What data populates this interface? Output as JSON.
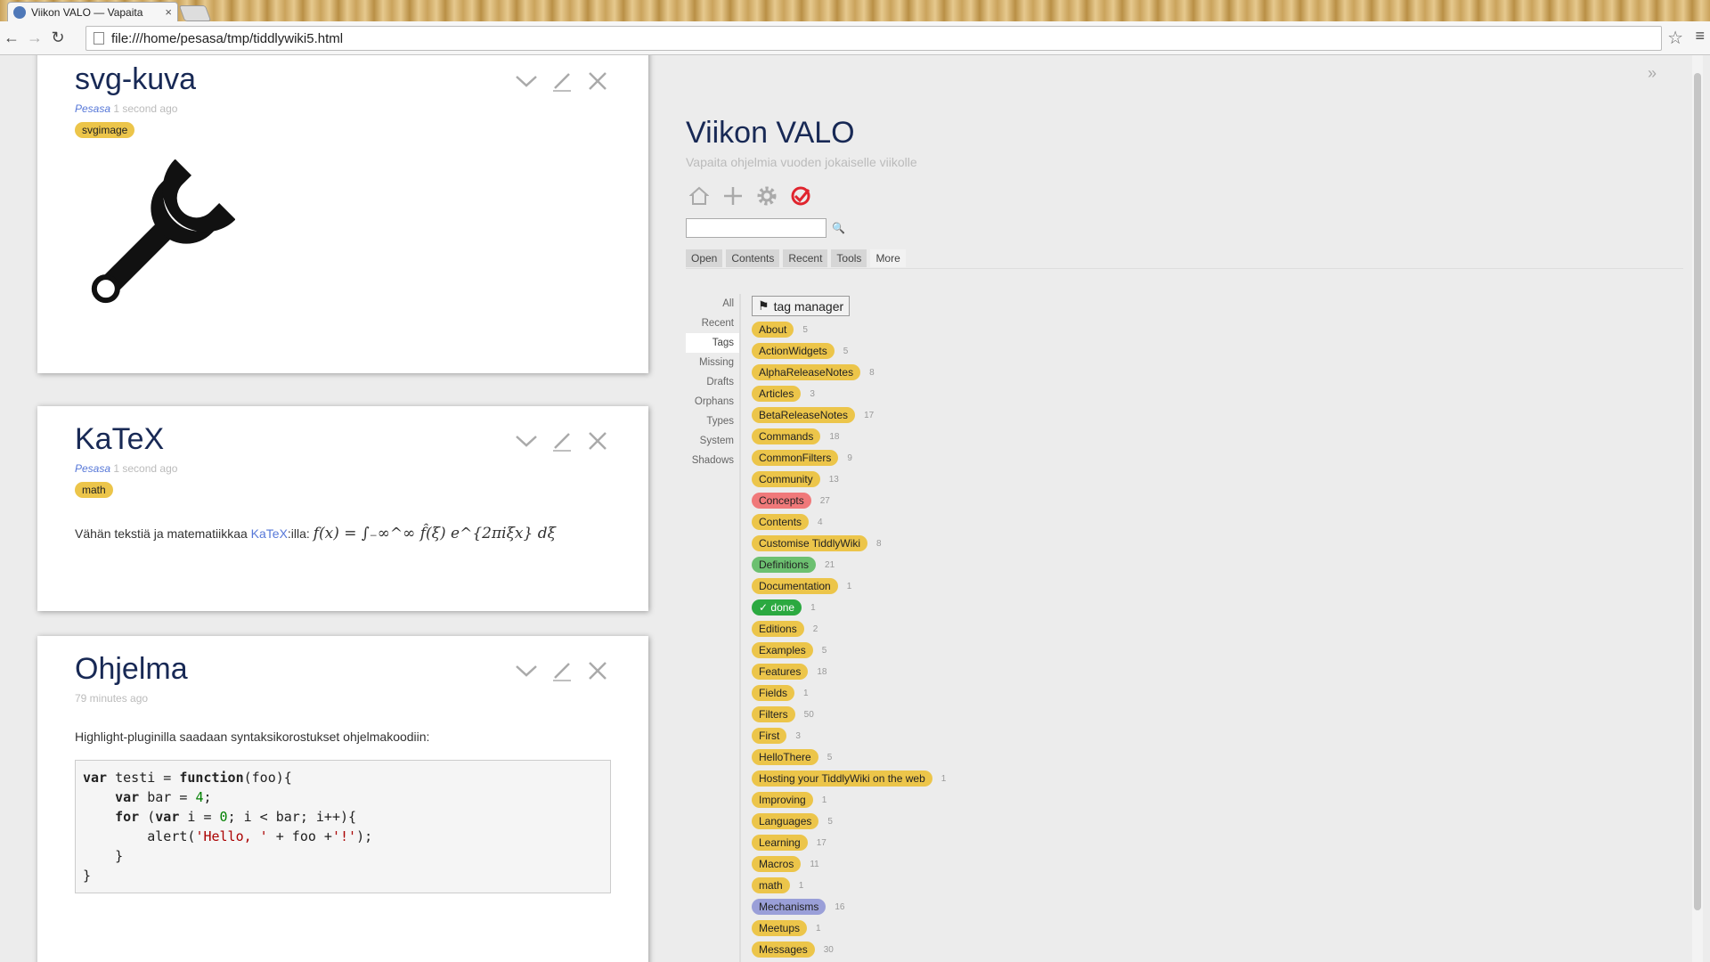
{
  "browser": {
    "tab_title": "Viikon VALO — Vapaita",
    "tab_close": "×",
    "url": "file:///home/pesasa/tmp/tiddlywiki5.html"
  },
  "story": {
    "tiddlers": [
      {
        "title": "svg-kuva",
        "modifier": "Pesasa",
        "modified": "1 second ago",
        "tag": "svgimage"
      },
      {
        "title": "KaTeX",
        "modifier": "Pesasa",
        "modified": "1 second ago",
        "tag": "math",
        "body_prefix": "Vähän tekstiä ja matematiikkaa ",
        "link": "KaTeX",
        "body_suffix": ":illa:",
        "formula": "f(x) = ∫₋∞^∞ f̂(ξ) e^{2πiξx} dξ"
      },
      {
        "title": "Ohjelma",
        "modified": "79 minutes ago",
        "body": "Highlight-pluginilla saadaan syntaksikorostukset ohjelmakoodiin:",
        "code": [
          "var testi = function(foo){",
          "    var bar = 4;",
          "    for (var i = 0; i < bar; i++){",
          "        alert('Hello, ' + foo +'!');",
          "    }",
          "}"
        ]
      }
    ]
  },
  "sidebar": {
    "site_title": "Viikon VALO",
    "site_subtitle": "Vapaita ohjelmia vuoden jokaiselle viikolle",
    "tabs": [
      "Open",
      "Contents",
      "Recent",
      "Tools",
      "More"
    ],
    "active_tab": "More",
    "subtabs": [
      "All",
      "Recent",
      "Tags",
      "Missing",
      "Drafts",
      "Orphans",
      "Types",
      "System",
      "Shadows"
    ],
    "active_subtab": "Tags",
    "tag_manager_label": "tag manager",
    "tags": [
      {
        "name": "About",
        "count": "5",
        "color": "#ecc54a"
      },
      {
        "name": "ActionWidgets",
        "count": "5",
        "color": "#ecc54a"
      },
      {
        "name": "AlphaReleaseNotes",
        "count": "8",
        "color": "#ecc54a"
      },
      {
        "name": "Articles",
        "count": "3",
        "color": "#ecc54a"
      },
      {
        "name": "BetaReleaseNotes",
        "count": "17",
        "color": "#ecc54a"
      },
      {
        "name": "Commands",
        "count": "18",
        "color": "#ecc54a"
      },
      {
        "name": "CommonFilters",
        "count": "9",
        "color": "#ecc54a"
      },
      {
        "name": "Community",
        "count": "13",
        "color": "#ecc54a"
      },
      {
        "name": "Concepts",
        "count": "27",
        "color": "#f0797a"
      },
      {
        "name": "Contents",
        "count": "4",
        "color": "#ecc54a"
      },
      {
        "name": "Customise TiddlyWiki",
        "count": "8",
        "color": "#ecc54a"
      },
      {
        "name": "Definitions",
        "count": "21",
        "color": "#6cc070"
      },
      {
        "name": "Documentation",
        "count": "1",
        "color": "#ecc54a"
      },
      {
        "name": "done",
        "count": "1",
        "color": "#2ba940"
      },
      {
        "name": "Editions",
        "count": "2",
        "color": "#ecc54a"
      },
      {
        "name": "Examples",
        "count": "5",
        "color": "#ecc54a"
      },
      {
        "name": "Features",
        "count": "18",
        "color": "#ecc54a"
      },
      {
        "name": "Fields",
        "count": "1",
        "color": "#ecc54a"
      },
      {
        "name": "Filters",
        "count": "50",
        "color": "#ecc54a"
      },
      {
        "name": "First",
        "count": "3",
        "color": "#ecc54a"
      },
      {
        "name": "HelloThere",
        "count": "5",
        "color": "#ecc54a"
      },
      {
        "name": "Hosting your TiddlyWiki on the web",
        "count": "1",
        "color": "#ecc54a"
      },
      {
        "name": "Improving",
        "count": "1",
        "color": "#ecc54a"
      },
      {
        "name": "Languages",
        "count": "5",
        "color": "#ecc54a"
      },
      {
        "name": "Learning",
        "count": "17",
        "color": "#ecc54a"
      },
      {
        "name": "Macros",
        "count": "11",
        "color": "#ecc54a"
      },
      {
        "name": "math",
        "count": "1",
        "color": "#ecc54a"
      },
      {
        "name": "Mechanisms",
        "count": "16",
        "color": "#9a9fd8"
      },
      {
        "name": "Meetups",
        "count": "1",
        "color": "#ecc54a"
      },
      {
        "name": "Messages",
        "count": "30",
        "color": "#ecc54a"
      }
    ]
  }
}
